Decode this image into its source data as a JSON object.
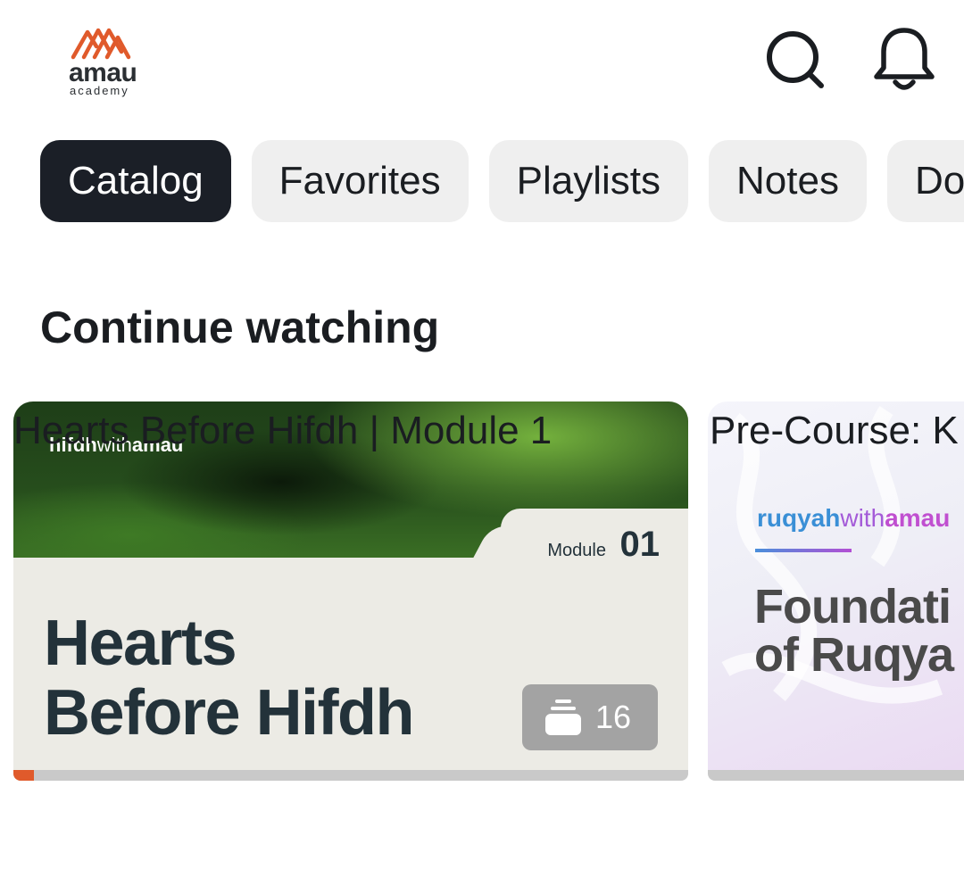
{
  "header": {
    "logo_word": "amau",
    "logo_sub": "academy",
    "logo_icon": "amau-logo-icon",
    "search_icon": "search-icon",
    "notification_icon": "bell-icon"
  },
  "tabs": [
    {
      "label": "Catalog",
      "active": true
    },
    {
      "label": "Favorites",
      "active": false
    },
    {
      "label": "Playlists",
      "active": false
    },
    {
      "label": "Notes",
      "active": false
    },
    {
      "label": "Do",
      "active": false
    }
  ],
  "section": {
    "title": "Continue watching"
  },
  "cards": [
    {
      "title": "Hearts Before Hifdh | Module 1",
      "brand": "hifdhwithamau",
      "brand_parts": [
        "hifdh",
        "with",
        "amau"
      ],
      "module_label": "Module",
      "module_number": "01",
      "heading_line1": "Hearts",
      "heading_line2": "Before Hifdh",
      "lesson_count": "16",
      "lesson_icon": "stack-icon",
      "progress_fraction": 0.03,
      "progress_color": "#e05a2b"
    },
    {
      "title": "Pre-Course: K",
      "brand_parts": [
        "ruqyah",
        "with",
        "amau"
      ],
      "heading": "Foundati\nof Ruqya",
      "progress_fraction": 0.0
    }
  ],
  "colors": {
    "active_tab_bg": "#1b1f27",
    "tab_bg": "#efefef",
    "text": "#1a1d21",
    "logo_accent": "#e05a2b"
  }
}
